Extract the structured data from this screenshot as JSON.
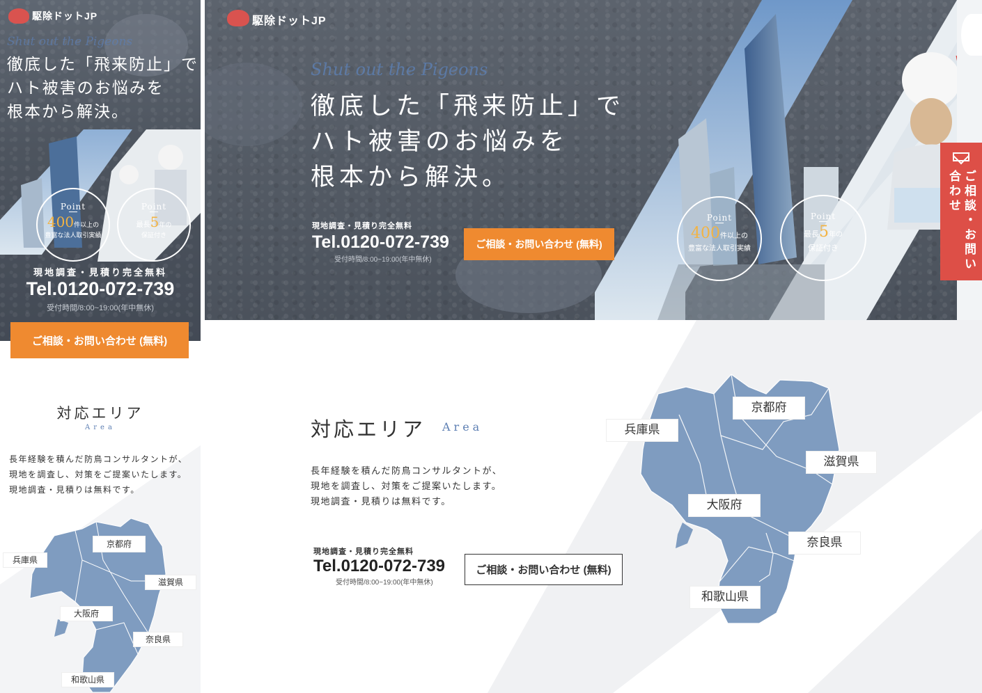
{
  "brand": {
    "name": "駆除ドットJP"
  },
  "hero": {
    "tagline_script": "Shut out the Pigeons",
    "headline_line1": "徹底した「飛来防止」で",
    "headline_line2": "ハト被害のお悩みを",
    "headline_line3": "根本から解決。",
    "free_note": "現地調査・見積り完全無料",
    "tel": "Tel.0120-072-739",
    "hours": "受付時間/8:00~19:00(年中無休)",
    "cta_label": "ご相談・お問い合わせ (無料)",
    "points": [
      {
        "label": "Point",
        "num": "400",
        "suffix": "件以上の",
        "desc": "豊富な法人取引実績"
      },
      {
        "label": "Point",
        "prefix": "最長",
        "num": "5",
        "suffix": "年の",
        "desc": "保証付き"
      }
    ]
  },
  "side_tab": {
    "label": "ご相談・お問い合わせ",
    "icon": "mail-icon"
  },
  "area": {
    "title": "対応エリア",
    "subtitle": "Area",
    "desc_line1": "長年経験を積んだ防鳥コンサルタントが、",
    "desc_line2": "現地を調査し、対策をご提案いたします。",
    "desc_line3": "現地調査・見積りは無料です。",
    "free_note": "現地調査・見積り完全無料",
    "tel": "Tel.0120-072-739",
    "hours": "受付時間/8:00~19:00(年中無休)",
    "cta_label": "ご相談・お問い合わせ (無料)",
    "prefectures": [
      "兵庫県",
      "京都府",
      "滋賀県",
      "大阪府",
      "奈良県",
      "和歌山県"
    ]
  },
  "colors": {
    "accent_orange": "#ef8a30",
    "tab_red": "#dd4f47",
    "map_blue": "#7f9cc0",
    "area_blue": "#5d7fb3"
  }
}
